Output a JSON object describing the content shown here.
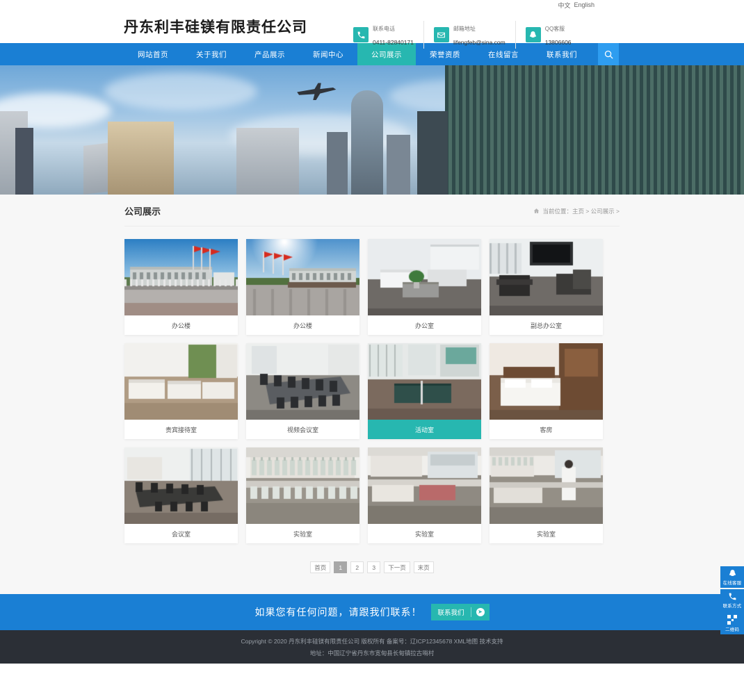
{
  "lang": {
    "zh": "中文",
    "en": "English"
  },
  "header": {
    "logo": "丹东利丰硅镁有限责任公司",
    "contacts": [
      {
        "icon": "phone-icon",
        "label": "联系电话",
        "value": "0411-82840171"
      },
      {
        "icon": "mail-icon",
        "label": "邮箱地址",
        "value": "lifengfeb@sina.com"
      },
      {
        "icon": "qq-icon",
        "label": "QQ客服",
        "value": "13806606"
      }
    ]
  },
  "nav": {
    "items": [
      {
        "label": "网站首页",
        "active": false
      },
      {
        "label": "关于我们",
        "active": false
      },
      {
        "label": "产品展示",
        "active": false
      },
      {
        "label": "新闻中心",
        "active": false
      },
      {
        "label": "公司展示",
        "active": true
      },
      {
        "label": "荣誉资质",
        "active": false
      },
      {
        "label": "在线留言",
        "active": false
      },
      {
        "label": "联系我们",
        "active": false
      }
    ],
    "search_icon": "search-icon"
  },
  "page": {
    "title": "公司展示",
    "breadcrumb": "当前位置：主页 > 公司展示 >"
  },
  "gallery": {
    "items": [
      {
        "caption": "办公楼",
        "active": false,
        "scene": "building-flags"
      },
      {
        "caption": "办公楼",
        "active": false,
        "scene": "building-sun"
      },
      {
        "caption": "办公室",
        "active": false,
        "scene": "office-lounge"
      },
      {
        "caption": "副总办公室",
        "active": false,
        "scene": "office-dark"
      },
      {
        "caption": "贵宾接待室",
        "active": false,
        "scene": "reception"
      },
      {
        "caption": "视频会议室",
        "active": false,
        "scene": "conference"
      },
      {
        "caption": "活动室",
        "active": true,
        "scene": "activity-room"
      },
      {
        "caption": "客房",
        "active": false,
        "scene": "guest-room"
      },
      {
        "caption": "会议室",
        "active": false,
        "scene": "meeting-room"
      },
      {
        "caption": "实验室",
        "active": false,
        "scene": "lab-bottles"
      },
      {
        "caption": "实验室",
        "active": false,
        "scene": "lab-bench"
      },
      {
        "caption": "实验室",
        "active": false,
        "scene": "lab-worker"
      }
    ]
  },
  "pagination": {
    "items": [
      {
        "label": "首页",
        "active": false
      },
      {
        "label": "1",
        "active": true
      },
      {
        "label": "2",
        "active": false
      },
      {
        "label": "3",
        "active": false
      },
      {
        "label": "下一页",
        "active": false
      },
      {
        "label": "末页",
        "active": false
      }
    ]
  },
  "cta": {
    "text": "如果您有任何问题，请跟我们联系！",
    "button": "联系我们",
    "arrow": "arrow-right-icon"
  },
  "footer": {
    "copyright": "Copyright © 2020 丹东利丰硅镁有限责任公司 版权所有 备案号：辽ICP12345678 XML地图 技术支持",
    "address": "地址：中国辽宁省丹东市宽甸县长甸镇拉古哨村"
  },
  "side_widget": {
    "items": [
      {
        "icon": "qq-icon",
        "label": "在线客服"
      },
      {
        "icon": "phone-icon",
        "label": "联系方式"
      },
      {
        "icon": "qr-icon",
        "label": "二维码"
      }
    ]
  },
  "colors": {
    "brand_blue": "#1a7fd4",
    "accent_teal": "#27b7b0",
    "footer_dark": "#2b2f36",
    "content_bg": "#f7f7f7"
  }
}
